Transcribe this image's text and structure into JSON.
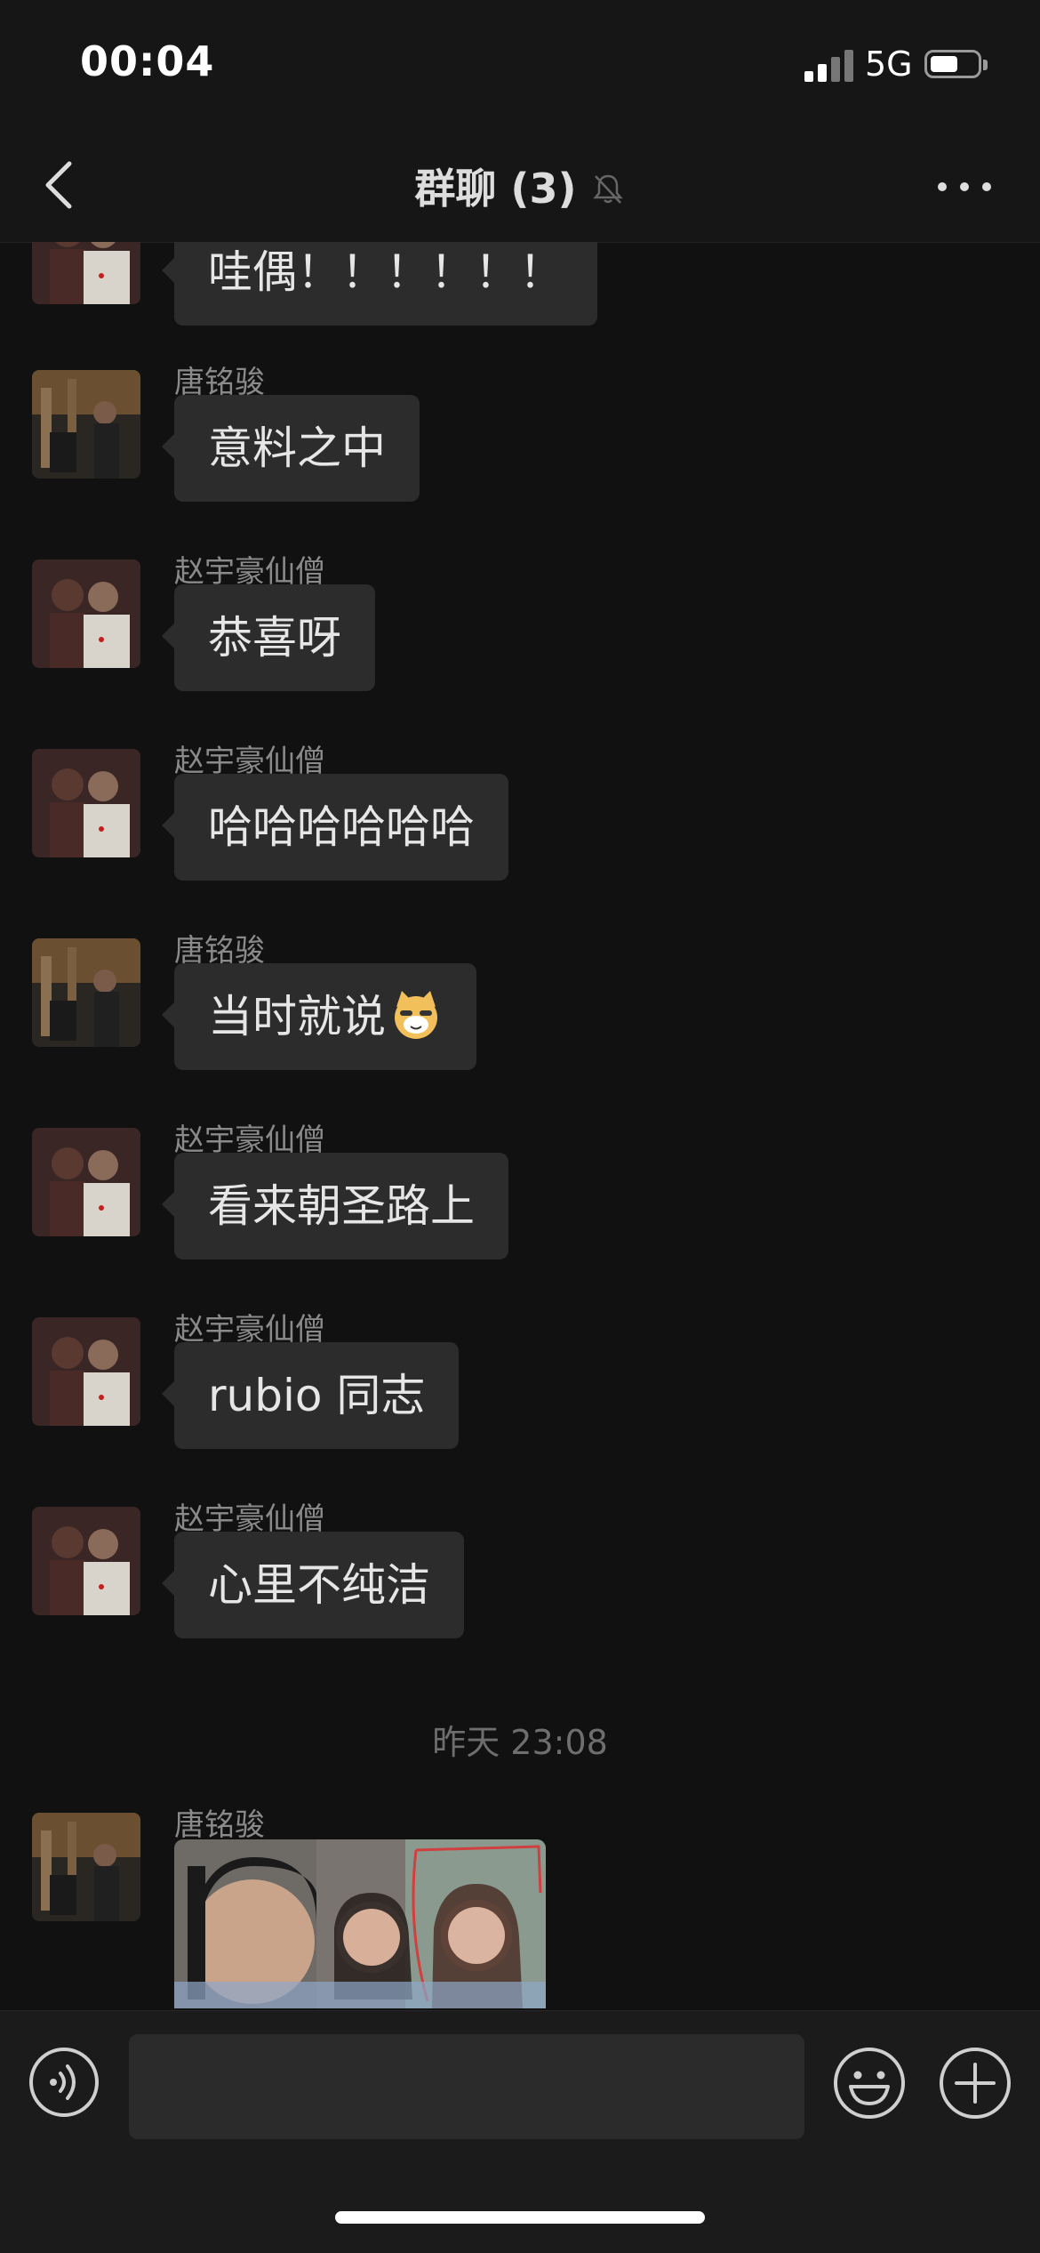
{
  "status_bar": {
    "time": "00:04",
    "network": "5G"
  },
  "header": {
    "title": "群聊 (3)"
  },
  "chat": {
    "messages": [
      {
        "sender": "",
        "text": "哇偶！！！！！！",
        "avatar": "person-b"
      },
      {
        "sender": "唐铭骏",
        "text": "意料之中",
        "avatar": "person-a"
      },
      {
        "sender": "赵宇豪仙僧",
        "text": "恭喜呀",
        "avatar": "person-b"
      },
      {
        "sender": "赵宇豪仙僧",
        "text": "哈哈哈哈哈哈",
        "avatar": "person-b"
      },
      {
        "sender": "唐铭骏",
        "text": "当时就说",
        "emoji": "cat-face-emoji",
        "avatar": "person-a"
      },
      {
        "sender": "赵宇豪仙僧",
        "text": "看来朝圣路上",
        "avatar": "person-b"
      },
      {
        "sender": "赵宇豪仙僧",
        "text": "rubio 同志",
        "avatar": "person-b"
      },
      {
        "sender": "赵宇豪仙僧",
        "text": "心里不纯洁",
        "avatar": "person-b"
      }
    ],
    "timestamp": "昨天 23:08",
    "image_message": {
      "sender": "唐铭骏",
      "avatar": "person-a"
    }
  },
  "input_bar": {
    "placeholder": ""
  },
  "colors": {
    "background": "#111111",
    "bubble": "#2c2c2c",
    "bar": "#161616",
    "muted_text": "#8a8a8a"
  }
}
